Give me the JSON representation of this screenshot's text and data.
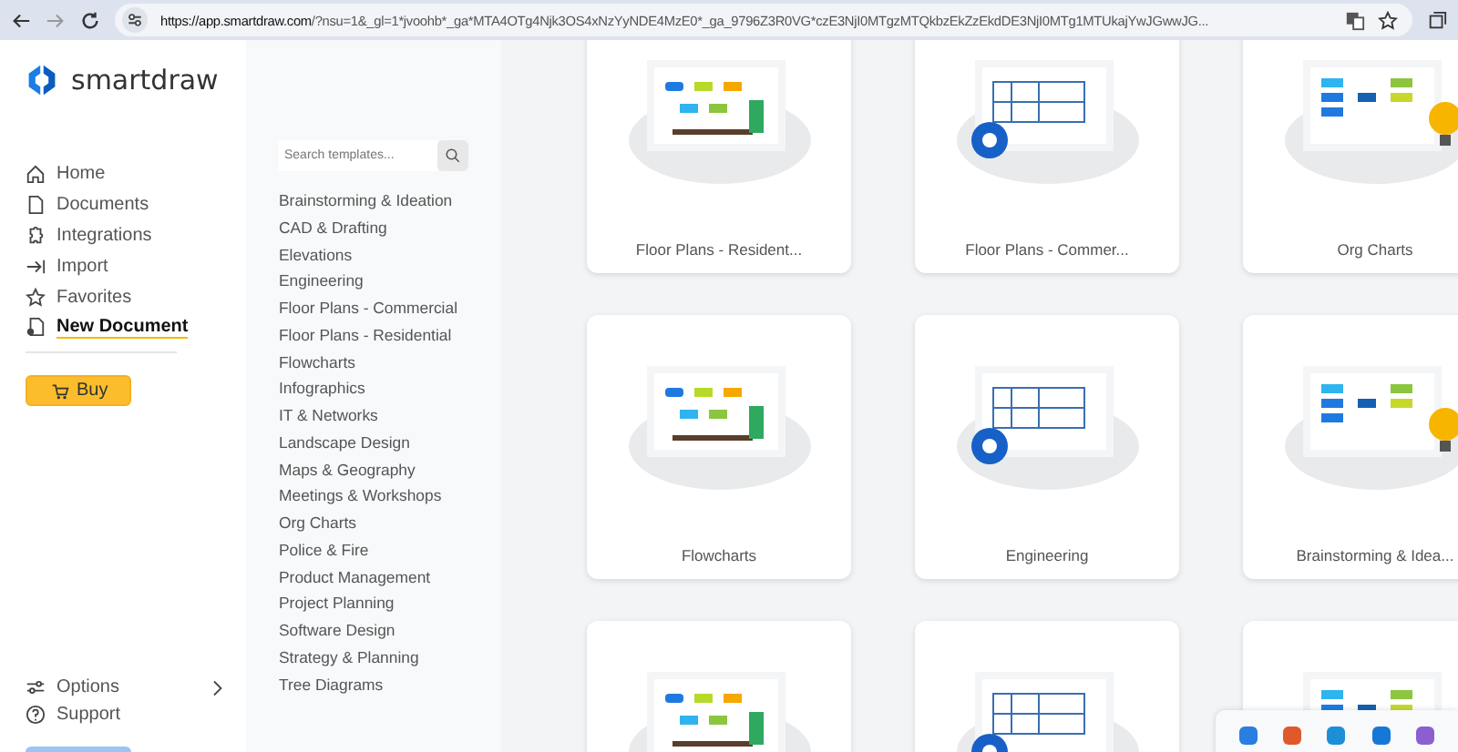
{
  "browser": {
    "url_host": "https://app.smartdraw.com",
    "url_rest": "/?nsu=1&_gl=1*jvoohb*_ga*MTA4OTg4Njk3OS4xNzYyNDE4MzE0*_ga_9796Z3R0VG*czE3NjI0MTgzMTQkbzEkZzEkdDE3NjI0MTg1MTUkajYwJGwwJG..."
  },
  "sidebar": {
    "logo": "smartdraw",
    "nav": [
      {
        "label": "Home",
        "selected": false
      },
      {
        "label": "Documents",
        "selected": false
      },
      {
        "label": "Integrations",
        "selected": false
      },
      {
        "label": "Import",
        "selected": false
      },
      {
        "label": "Favorites",
        "selected": false
      },
      {
        "label": "New Document",
        "selected": true
      }
    ],
    "buy": "Buy",
    "bottom": [
      {
        "label": "Options",
        "kind": "submenu"
      },
      {
        "label": "Support",
        "kind": "plain"
      }
    ]
  },
  "templates": {
    "search": {
      "placeholder": "Search templates..."
    },
    "categories": [
      "Brainstorming & Ideation",
      "CAD & Drafting",
      "Elevations",
      "Engineering",
      "Floor Plans - Commercial",
      "Floor Plans - Residential",
      "Flowcharts",
      "Infographics",
      "IT & Networks",
      "Landscape Design",
      "Maps & Geography",
      "Meetings & Workshops",
      "Org Charts",
      "Police & Fire",
      "Product Management",
      "Project Planning",
      "Software Design",
      "Strategy & Planning",
      "Tree Diagrams"
    ]
  },
  "cards": [
    {
      "kind": "titled",
      "title": "Floor Plans - Resident..."
    },
    {
      "kind": "titled",
      "title": "Floor Plans - Commer..."
    },
    {
      "kind": "titled",
      "title": "Org Charts"
    },
    {
      "kind": "titled",
      "title": "Flowcharts"
    },
    {
      "kind": "titled",
      "title": "Engineering"
    },
    {
      "kind": "titled",
      "title": "Brainstorming & Idea..."
    },
    {
      "kind": "partial"
    },
    {
      "kind": "partial"
    },
    {
      "kind": "partial"
    }
  ]
}
